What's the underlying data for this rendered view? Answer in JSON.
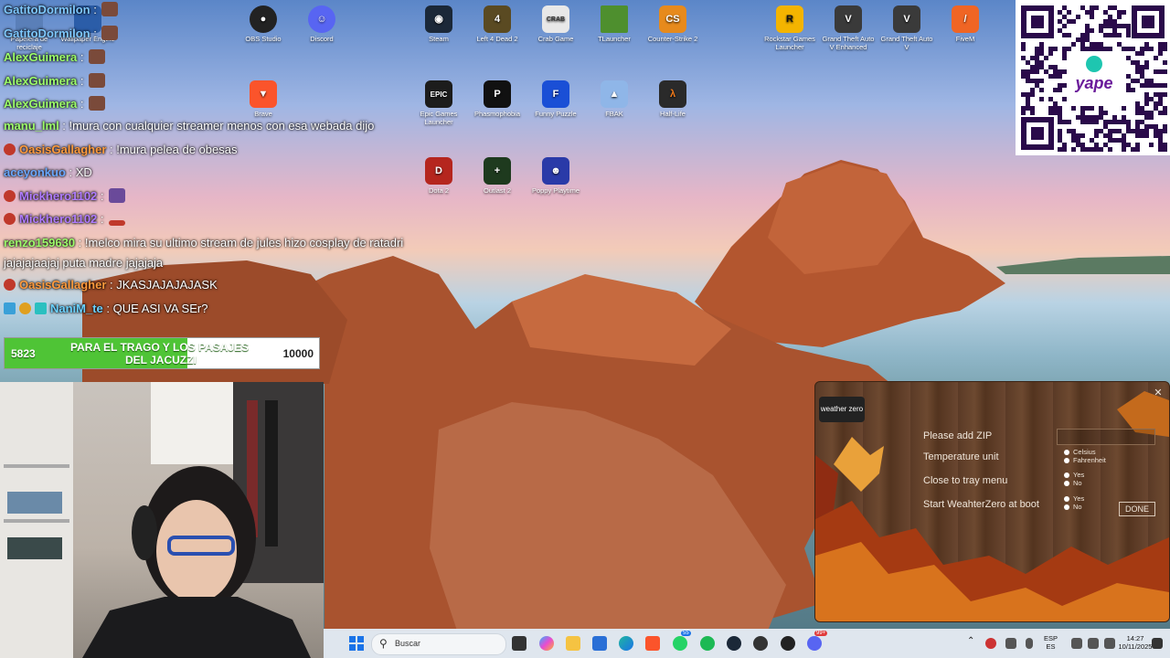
{
  "desktop_icons": [
    {
      "label": "Papelera de reciclaje",
      "color": "#5a7fb8"
    },
    {
      "label": "Wallpaper Engine",
      "color": "#2b5da8"
    },
    {
      "label": "OBS Studio",
      "color": "#222222"
    },
    {
      "label": "Discord",
      "color": "#5865f2"
    },
    {
      "label": "Steam",
      "color": "#1b2838"
    },
    {
      "label": "Left 4 Dead 2",
      "color": "#5a4a22"
    },
    {
      "label": "Crab Game",
      "color": "#e8e8e8"
    },
    {
      "label": "TLauncher",
      "color": "#4e8f2e"
    },
    {
      "label": "Counter-Strike 2",
      "color": "#e78a1c"
    },
    {
      "label": "Rockstar Games Launcher",
      "color": "#f4b400"
    },
    {
      "label": "Grand Theft Auto V Enhanced",
      "color": "#3a3a3a"
    },
    {
      "label": "Grand Theft Auto V",
      "color": "#3a3a3a"
    },
    {
      "label": "FiveM",
      "color": "#f06524"
    },
    {
      "label": "Brave",
      "color": "#fb542b"
    },
    {
      "label": "Epic Games Launcher",
      "color": "#1c1c1c"
    },
    {
      "label": "Phasmophobia",
      "color": "#111111"
    },
    {
      "label": "Funny Puzzle",
      "color": "#1a4fd6"
    },
    {
      "label": "FBAK",
      "color": "#8fb6e8"
    },
    {
      "label": "Half-Life",
      "color": "#2a2a2a"
    },
    {
      "label": "Dota 2",
      "color": "#b5261e"
    },
    {
      "label": "Outlast 2",
      "color": "#1e3a1e"
    },
    {
      "label": "Poppy Playtime",
      "color": "#2a3aa8"
    }
  ],
  "chat": [
    {
      "name": "GatitoDormilon",
      "sep": " : ",
      "msg": "",
      "name_color": "#7ec8ff"
    },
    {
      "name": "GatitoDormilon",
      "sep": " : ",
      "msg": "",
      "name_color": "#7ec8ff"
    },
    {
      "name": "AlexGuimera",
      "sep": " : ",
      "msg": "",
      "name_color": "#9dff6a"
    },
    {
      "name": "AlexGuimera",
      "sep": " : ",
      "msg": "",
      "name_color": "#9dff6a"
    },
    {
      "name": "AlexGuimera",
      "sep": " : ",
      "msg": "",
      "name_color": "#9dff6a"
    },
    {
      "name": "manu_lml",
      "sep": " : ",
      "msg": "!mura con cualquier streamer menos con esa webada dijo",
      "name_color": "#9dff6a"
    },
    {
      "name": "OasisGallagher",
      "sep": " : ",
      "msg": "!mura pelea de obesas",
      "name_color": "#ff9a3c"
    },
    {
      "name": "aceyonkuo",
      "sep": " : ",
      "msg": "XD",
      "name_color": "#6aa8ff"
    },
    {
      "name": "Mickhero1102",
      "sep": " : ",
      "msg": "",
      "name_color": "#b07cff"
    },
    {
      "name": "Mickhero1102",
      "sep": " : ",
      "msg": "",
      "name_color": "#b07cff"
    },
    {
      "name": "renzo159630",
      "sep": " : ",
      "msg": "!melco mira su ultimo stream de jules hizo cosplay de ratadri",
      "name_color": "#9dff6a"
    },
    {
      "name": "",
      "sep": "",
      "msg": "jajajajaajaj puta madre jajajaja",
      "name_color": "#ffffff"
    },
    {
      "name": "OasisGallagher",
      "sep": " : ",
      "msg": "JKASJAJAJAJASK",
      "name_color": "#ff9a3c"
    },
    {
      "name": "NaniM_te",
      "sep": " : ",
      "msg": "QUE ASI VA SEr?",
      "name_color": "#6ad1ff"
    }
  ],
  "goal": {
    "current": "5823",
    "text_line1": "PARA EL TRAGO Y LOS PASAJES",
    "text_line2": "DEL JACUZZI",
    "target": "10000",
    "progress": 0.5823
  },
  "qr": {
    "brand": "yape"
  },
  "weather_widget": {
    "logo": "weather zero",
    "rows": [
      {
        "label": "Please add ZIP"
      },
      {
        "label": "Temperature unit",
        "options": [
          "Celsius",
          "Fahrenheit"
        ]
      },
      {
        "label": "Close to tray menu",
        "options": [
          "Yes",
          "No"
        ]
      },
      {
        "label": "Start WeahterZero at boot",
        "options": [
          "Yes",
          "No"
        ]
      }
    ],
    "done_label": "DONE"
  },
  "taskbar": {
    "search_placeholder": "Buscar",
    "whatsapp_badge": "55",
    "discord_badge": "99+",
    "lang_line1": "ESP",
    "lang_line2": "ES",
    "time": "14:27",
    "date": "10/11/2025"
  }
}
